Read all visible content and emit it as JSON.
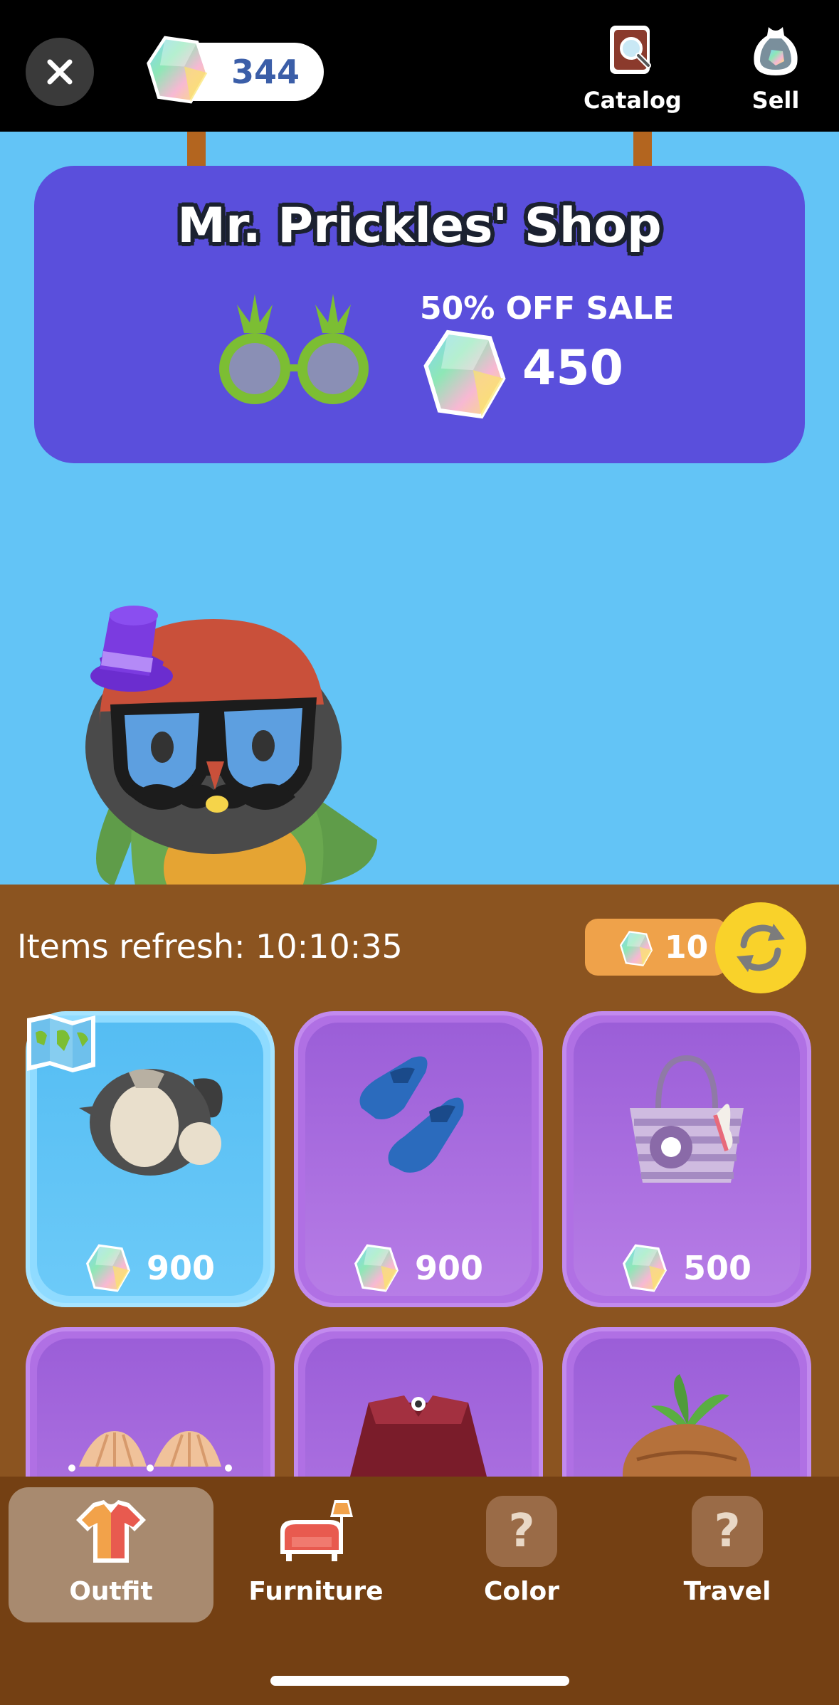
{
  "header": {
    "gem_count": "344",
    "actions": [
      {
        "label": "Catalog",
        "icon": "catalog-book-icon"
      },
      {
        "label": "Sell",
        "icon": "sell-bag-icon"
      }
    ]
  },
  "banner": {
    "title": "Mr. Prickles' Shop",
    "sale_label": "50% OFF SALE",
    "sale_price": "450",
    "featured_item": "pineapple-sunglasses"
  },
  "shop": {
    "refresh_label": "Items refresh: 10:10:35",
    "refresh_cost": "10",
    "items": [
      {
        "name": "penguin-body-outfit",
        "price": "900",
        "style": "blue"
      },
      {
        "name": "blue-flippers",
        "price": "900",
        "style": "purple"
      },
      {
        "name": "striped-beach-bag",
        "price": "500",
        "style": "purple"
      },
      {
        "name": "seashell-top",
        "price": "",
        "style": "purple"
      },
      {
        "name": "red-cape",
        "price": "",
        "style": "purple"
      },
      {
        "name": "onion-hat",
        "price": "",
        "style": "purple"
      }
    ]
  },
  "nav": {
    "items": [
      {
        "label": "Outfit",
        "active": true
      },
      {
        "label": "Furniture",
        "active": false
      },
      {
        "label": "Color",
        "active": false
      },
      {
        "label": "Travel",
        "active": false
      }
    ],
    "locked_glyph": "?"
  },
  "colors": {
    "sky": "#63c4f6",
    "banner": "#5a4fdc",
    "shop_bg": "#8b5420",
    "nav_bg": "#744013",
    "card_purple": "#b070e4",
    "card_blue": "#8fdbff"
  }
}
